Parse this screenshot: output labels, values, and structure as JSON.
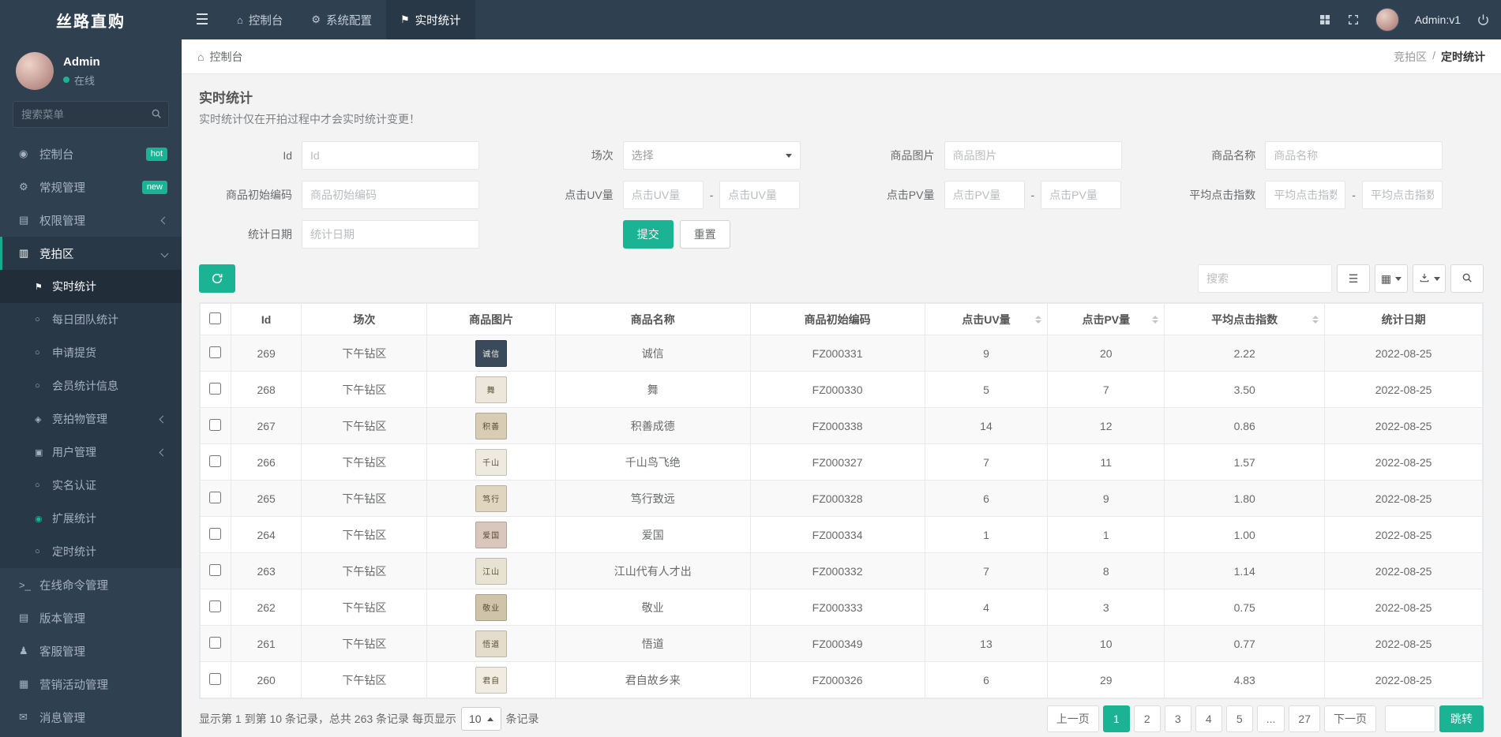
{
  "colors": {
    "primary": "#1ab394",
    "sidebar_bg": "#2f4050",
    "active_bg": "#293846",
    "accent_border": "#19aa8d"
  },
  "topbar": {
    "logo": "丝路直购",
    "items": [
      {
        "key": "console",
        "label": "控制台",
        "icon": "⌂",
        "icon_name": "dashboard-icon",
        "active": false
      },
      {
        "key": "system-config",
        "label": "系统配置",
        "icon": "⚙",
        "icon_name": "gear-icon",
        "active": false
      },
      {
        "key": "realtime-stats",
        "label": "实时统计",
        "icon": "⚑",
        "icon_name": "flag-icon",
        "active": true
      }
    ],
    "user_label": "Admin:v1"
  },
  "sidebar": {
    "user": {
      "name": "Admin",
      "status": "在线"
    },
    "search_placeholder": "搜索菜单",
    "items": [
      {
        "key": "console",
        "label": "控制台",
        "icon": "◉",
        "icon_name": "dashboard-icon",
        "badge": "hot"
      },
      {
        "key": "general",
        "label": "常规管理",
        "icon": "⚙",
        "icon_name": "gear-icon",
        "badge": "new"
      },
      {
        "key": "permission",
        "label": "权限管理",
        "icon": "▤",
        "icon_name": "users-icon",
        "chevron": "left"
      },
      {
        "key": "auction-zone",
        "label": "竞拍区",
        "icon": "▥",
        "icon_name": "list-icon",
        "chevron": "down",
        "active": true,
        "children": [
          {
            "key": "realtime-stats",
            "label": "实时统计",
            "icon": "⚑",
            "icon_name": "pin-icon",
            "active": true
          },
          {
            "key": "daily-team-stats",
            "label": "每日团队统计",
            "icon": "○",
            "icon_name": "circle-icon"
          },
          {
            "key": "pickup-request",
            "label": "申请提货",
            "icon": "○",
            "icon_name": "circle-icon"
          },
          {
            "key": "member-stats",
            "label": "会员统计信息",
            "icon": "○",
            "icon_name": "circle-icon"
          },
          {
            "key": "auction-items",
            "label": "竞拍物管理",
            "icon": "◈",
            "icon_name": "diamond-icon",
            "chevron": "left"
          },
          {
            "key": "user-management",
            "label": "用户管理",
            "icon": "▣",
            "icon_name": "square-icon",
            "chevron": "left"
          },
          {
            "key": "real-name-auth",
            "label": "实名认证",
            "icon": "○",
            "icon_name": "circle-icon"
          },
          {
            "key": "extended-stats",
            "label": "扩展统计",
            "icon": "◉",
            "icon_name": "filled-circle-icon",
            "icon_color": "#1ab394"
          },
          {
            "key": "timed-stats",
            "label": "定时统计",
            "icon": "○",
            "icon_name": "circle-icon"
          }
        ]
      },
      {
        "key": "online-command",
        "label": "在线命令管理",
        "icon": ">_",
        "icon_name": "terminal-icon"
      },
      {
        "key": "version",
        "label": "版本管理",
        "icon": "▤",
        "icon_name": "box-icon"
      },
      {
        "key": "customer-service",
        "label": "客服管理",
        "icon": "♟",
        "icon_name": "support-icon"
      },
      {
        "key": "marketing",
        "label": "营销活动管理",
        "icon": "▦",
        "icon_name": "campaign-icon"
      },
      {
        "key": "message",
        "label": "消息管理",
        "icon": "✉",
        "icon_name": "message-icon"
      }
    ]
  },
  "breadcrumb": {
    "left_icon": "⌂",
    "left": "控制台",
    "parent": "竞拍区",
    "separator": "/",
    "current": "定时统计"
  },
  "page": {
    "title": "实时统计",
    "subtitle": "实时统计仅在开拍过程中才会实时统计变更！"
  },
  "filters": {
    "rows": [
      [
        {
          "key": "id",
          "label": "Id",
          "type": "text",
          "placeholder": "Id"
        },
        {
          "key": "session",
          "label": "场次",
          "type": "select",
          "value": "选择"
        },
        {
          "key": "image",
          "label": "商品图片",
          "type": "text",
          "placeholder": "商品图片"
        },
        {
          "key": "name",
          "label": "商品名称",
          "type": "text",
          "placeholder": "商品名称"
        }
      ],
      [
        {
          "key": "code",
          "label": "商品初始编码",
          "type": "text",
          "placeholder": "商品初始编码"
        },
        {
          "key": "uv",
          "label": "点击UV量",
          "type": "range",
          "placeholder": "点击UV量"
        },
        {
          "key": "pv",
          "label": "点击PV量",
          "type": "range",
          "placeholder": "点击PV量"
        },
        {
          "key": "avg",
          "label": "平均点击指数",
          "type": "range",
          "placeholder": "平均点击指数"
        }
      ],
      [
        {
          "key": "date",
          "label": "统计日期",
          "type": "text",
          "placeholder": "统计日期"
        },
        {
          "key": "buttons",
          "type": "buttons"
        }
      ]
    ],
    "submit_label": "提交",
    "reset_label": "重置"
  },
  "toolbar": {
    "search_placeholder": "搜索"
  },
  "icons": {
    "list_view": "☰",
    "columns": "▦"
  },
  "table": {
    "checkbox_col_width": "2.4%",
    "columns": [
      {
        "key": "id",
        "label": "Id",
        "width": "5.5%"
      },
      {
        "key": "session",
        "label": "场次",
        "width": "9.8%"
      },
      {
        "key": "image",
        "label": "商品图片",
        "width": "10%"
      },
      {
        "key": "name",
        "label": "商品名称",
        "width": "15.2%"
      },
      {
        "key": "code",
        "label": "商品初始编码",
        "width": "13.6%"
      },
      {
        "key": "uv",
        "label": "点击UV量",
        "width": "9.6%",
        "sortable": true
      },
      {
        "key": "pv",
        "label": "点击PV量",
        "width": "9.1%",
        "sortable": true
      },
      {
        "key": "avg",
        "label": "平均点击指数",
        "width": "12.5%",
        "sortable": true
      },
      {
        "key": "date",
        "label": "统计日期",
        "width": "12.3%"
      }
    ],
    "rows": [
      {
        "id": "269",
        "session": "下午钻区",
        "name": "诚信",
        "code": "FZ000331",
        "uv": "9",
        "pv": "20",
        "avg": "2.22",
        "date": "2022-08-25",
        "thumb_bg": "#3a4a5a",
        "thumb_fg": "#f2ede0"
      },
      {
        "id": "268",
        "session": "下午钻区",
        "name": "舞",
        "code": "FZ000330",
        "uv": "5",
        "pv": "7",
        "avg": "3.50",
        "date": "2022-08-25",
        "thumb_bg": "#ece7da",
        "thumb_fg": "#5a4f38"
      },
      {
        "id": "267",
        "session": "下午钻区",
        "name": "积善成德",
        "code": "FZ000338",
        "uv": "14",
        "pv": "12",
        "avg": "0.86",
        "date": "2022-08-25",
        "thumb_bg": "#d8cdb4",
        "thumb_fg": "#5a4f38"
      },
      {
        "id": "266",
        "session": "下午钻区",
        "name": "千山鸟飞绝",
        "code": "FZ000327",
        "uv": "7",
        "pv": "11",
        "avg": "1.57",
        "date": "2022-08-25",
        "thumb_bg": "#efeae0",
        "thumb_fg": "#5a4f38"
      },
      {
        "id": "265",
        "session": "下午钻区",
        "name": "笃行致远",
        "code": "FZ000328",
        "uv": "6",
        "pv": "9",
        "avg": "1.80",
        "date": "2022-08-25",
        "thumb_bg": "#e0d6c0",
        "thumb_fg": "#5a4f38"
      },
      {
        "id": "264",
        "session": "下午钻区",
        "name": "爱国",
        "code": "FZ000334",
        "uv": "1",
        "pv": "1",
        "avg": "1.00",
        "date": "2022-08-25",
        "thumb_bg": "#d9c7bd",
        "thumb_fg": "#5a4f38"
      },
      {
        "id": "263",
        "session": "下午钻区",
        "name": "江山代有人才出",
        "code": "FZ000332",
        "uv": "7",
        "pv": "8",
        "avg": "1.14",
        "date": "2022-08-25",
        "thumb_bg": "#e8e2d2",
        "thumb_fg": "#5a4f38"
      },
      {
        "id": "262",
        "session": "下午钻区",
        "name": "敬业",
        "code": "FZ000333",
        "uv": "4",
        "pv": "3",
        "avg": "0.75",
        "date": "2022-08-25",
        "thumb_bg": "#cfc4a9",
        "thumb_fg": "#5a4f38"
      },
      {
        "id": "261",
        "session": "下午钻区",
        "name": "悟道",
        "code": "FZ000349",
        "uv": "13",
        "pv": "10",
        "avg": "0.77",
        "date": "2022-08-25",
        "thumb_bg": "#e5ddcb",
        "thumb_fg": "#5a4f38"
      },
      {
        "id": "260",
        "session": "下午钻区",
        "name": "君自故乡来",
        "code": "FZ000326",
        "uv": "6",
        "pv": "29",
        "avg": "4.83",
        "date": "2022-08-25",
        "thumb_bg": "#f0ece2",
        "thumb_fg": "#5a4f38"
      }
    ]
  },
  "footer": {
    "summary_prefix": "显示第 1 到第 10 条记录，总共 263 条记录 每页显示",
    "page_size": "10",
    "summary_suffix": "条记录"
  },
  "pagination": {
    "prev_label": "上一页",
    "pages": [
      "1",
      "2",
      "3",
      "4",
      "5",
      "...",
      "27"
    ],
    "active": "1",
    "next_label": "下一页",
    "jump_label": "跳转"
  }
}
